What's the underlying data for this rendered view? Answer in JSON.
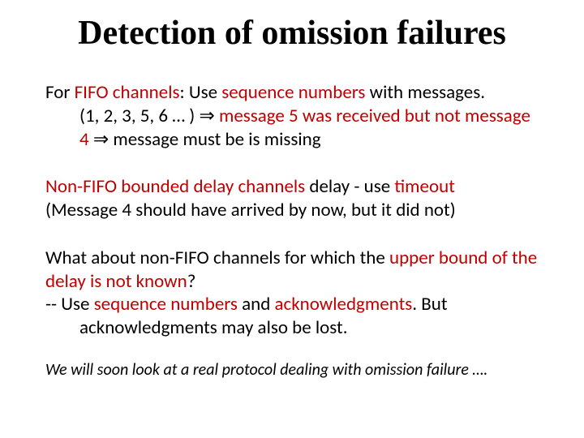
{
  "title": "Detection of omission failures",
  "p1": {
    "a": "For ",
    "b": "FIFO channels",
    "c": ": Use ",
    "d": "sequence numbers",
    "e": " with messages.",
    "line2a": "(1, 2, 3, 5, 6 … ) ⇒ ",
    "line2b": "message 5 was received but not message 4",
    "line2c": "  ⇒ message must be is missing"
  },
  "p2": {
    "a": "Non-FIFO bounded delay channels",
    "b": " delay - use ",
    "c": "timeout",
    "d": "(Message 4 should have arrived by now, but it did not)"
  },
  "p3": {
    "a": "What about non-FIFO channels for which the ",
    "b": "upper bound of the delay is not known",
    "c": "?",
    "d": "-- Use ",
    "e": "sequence numbers",
    "f": " and ",
    "g": "acknowledgments",
    "h": ". But",
    "i": "acknowledgments may also be lost."
  },
  "footnote": "We will soon look at a real protocol dealing with omission failure …."
}
